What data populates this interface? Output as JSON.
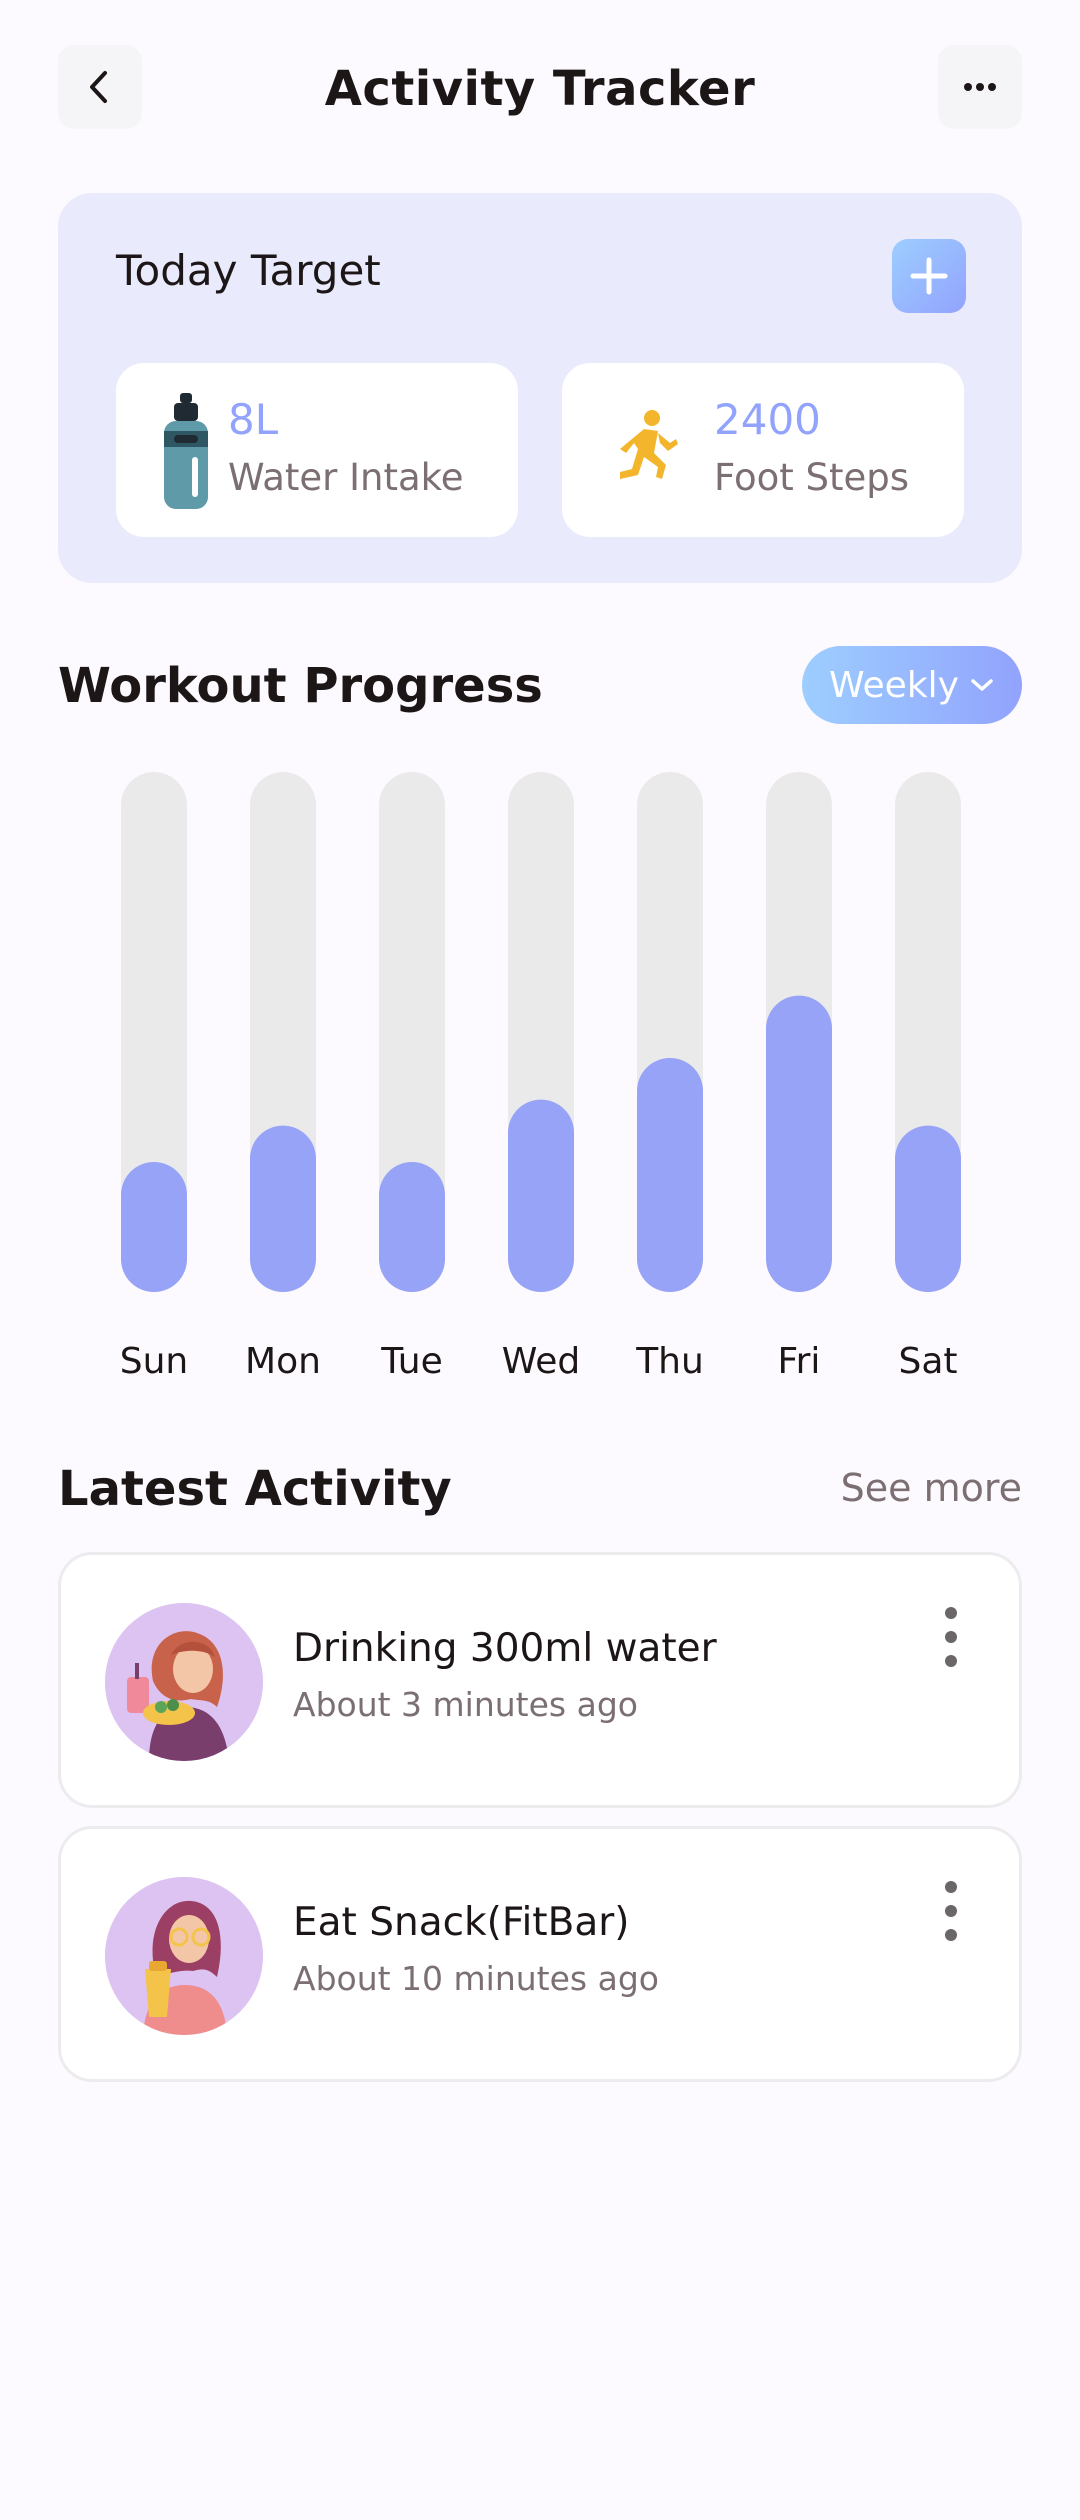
{
  "header": {
    "title": "Activity Tracker",
    "back_icon": "chevron-left-icon",
    "more_icon": "more-horizontal-icon"
  },
  "today_target": {
    "title": "Today Target",
    "add_icon": "plus-icon",
    "stats": [
      {
        "value": "8L",
        "label": "Water Intake",
        "icon": "water-bottle-icon"
      },
      {
        "value": "2400",
        "label": "Foot Steps",
        "icon": "running-person-icon"
      }
    ]
  },
  "workout_progress": {
    "title": "Workout Progress",
    "period_label": "Weekly",
    "period_icon": "chevron-down-icon"
  },
  "chart_data": {
    "type": "bar",
    "categories": [
      "Sun",
      "Mon",
      "Tue",
      "Wed",
      "Thu",
      "Fri",
      "Sat"
    ],
    "values": [
      25,
      32,
      25,
      37,
      45,
      57,
      32
    ],
    "ylim": [
      0,
      100
    ],
    "grid": false,
    "colors": {
      "bar": "#97a3f6",
      "track": "#ebeaeb"
    }
  },
  "latest_activity": {
    "title": "Latest Activity",
    "see_more": "See more",
    "items": [
      {
        "title": "Drinking 300ml water",
        "time": "About 3 minutes ago",
        "avatar": "woman-drinking-avatar"
      },
      {
        "title": "Eat Snack(FitBar)",
        "time": "About 10 minutes ago",
        "avatar": "woman-snack-avatar"
      }
    ]
  },
  "colors": {
    "accent": "#92a3fd",
    "accent_light": "#9dceff",
    "card_bg": "#e9eafc",
    "steps_icon": "#f3b52b"
  }
}
